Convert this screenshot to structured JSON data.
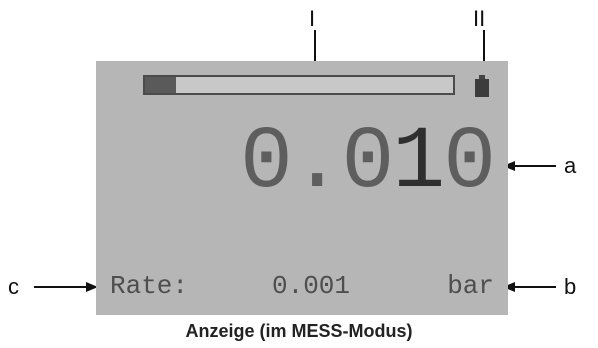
{
  "callouts": {
    "label_I": "I",
    "label_II": "II",
    "label_a": "a",
    "label_b": "b",
    "label_c": "c"
  },
  "display": {
    "progress_fraction": 0.1,
    "reading": {
      "prefix": "0.0",
      "cursor_digit": "1",
      "suffix": "0"
    },
    "rate_label": "Rate:",
    "rate_value": "0.001",
    "unit": "bar",
    "battery_icon": "battery-icon"
  },
  "caption": "Anzeige (im MESS-Modus)"
}
